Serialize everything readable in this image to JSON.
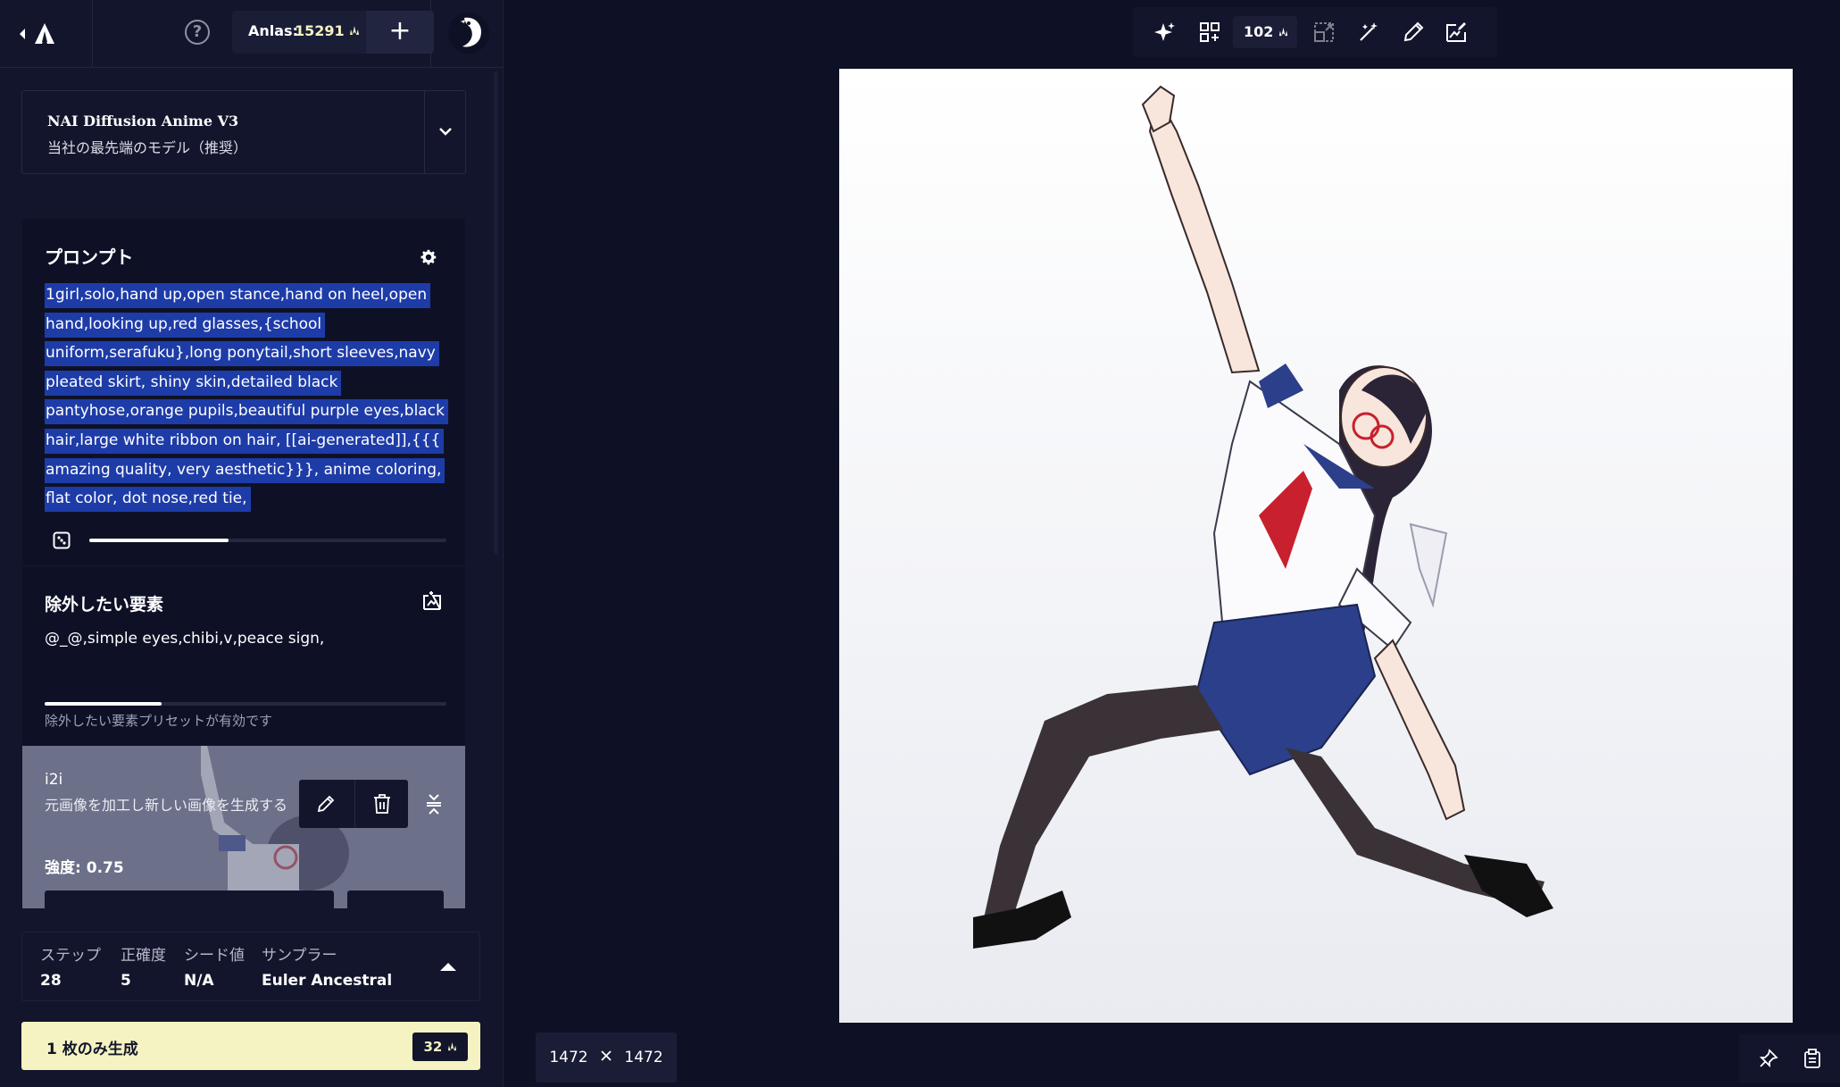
{
  "topbar": {
    "anlas_label": "Anlas:",
    "anlas_value": "15291",
    "add_label": "+"
  },
  "model": {
    "name": "NAI Diffusion Anime V3",
    "description": "当社の最先端のモデル（推奨）"
  },
  "prompt": {
    "title": "プロンプト",
    "text": "1girl,solo,hand up,open stance,hand on heel,open hand,looking up,red glasses,{school uniform,serafuku},long ponytail,short sleeves,navy pleated skirt, shiny skin,detailed black pantyhose,orange pupils,beautiful purple eyes,black hair,large white ribbon on hair, [[ai-generated]],{{{ amazing quality, very aesthetic}}}, anime coloring, flat color, dot nose,red tie,",
    "strength_fraction": 0.39
  },
  "negative": {
    "title": "除外したい要素",
    "text": "@_@,simple eyes,chibi,v,peace sign,",
    "strength_fraction": 0.29,
    "note": "除外したい要素プリセットが有効です"
  },
  "i2i": {
    "title": "i2i",
    "description": "元画像を加工し新しい画像を生成する",
    "strength_label": "強度:",
    "strength_value": "0.75"
  },
  "settings": {
    "steps_label": "ステップ",
    "steps_value": "28",
    "scale_label": "正確度",
    "scale_value": "5",
    "seed_label": "シード値",
    "seed_value": "N/A",
    "sampler_label": "サンプラー",
    "sampler_value": "Euler Ancestral"
  },
  "generate": {
    "label": "1 枚のみ生成",
    "cost": "32"
  },
  "toolbar": {
    "batch_count": "102"
  },
  "image": {
    "width": "1472",
    "height": "1472"
  },
  "colors": {
    "background": "#0e1126",
    "sidebar": "#13152c",
    "accent_yellow": "#f5f3c1",
    "selection": "#1e3ca8"
  }
}
